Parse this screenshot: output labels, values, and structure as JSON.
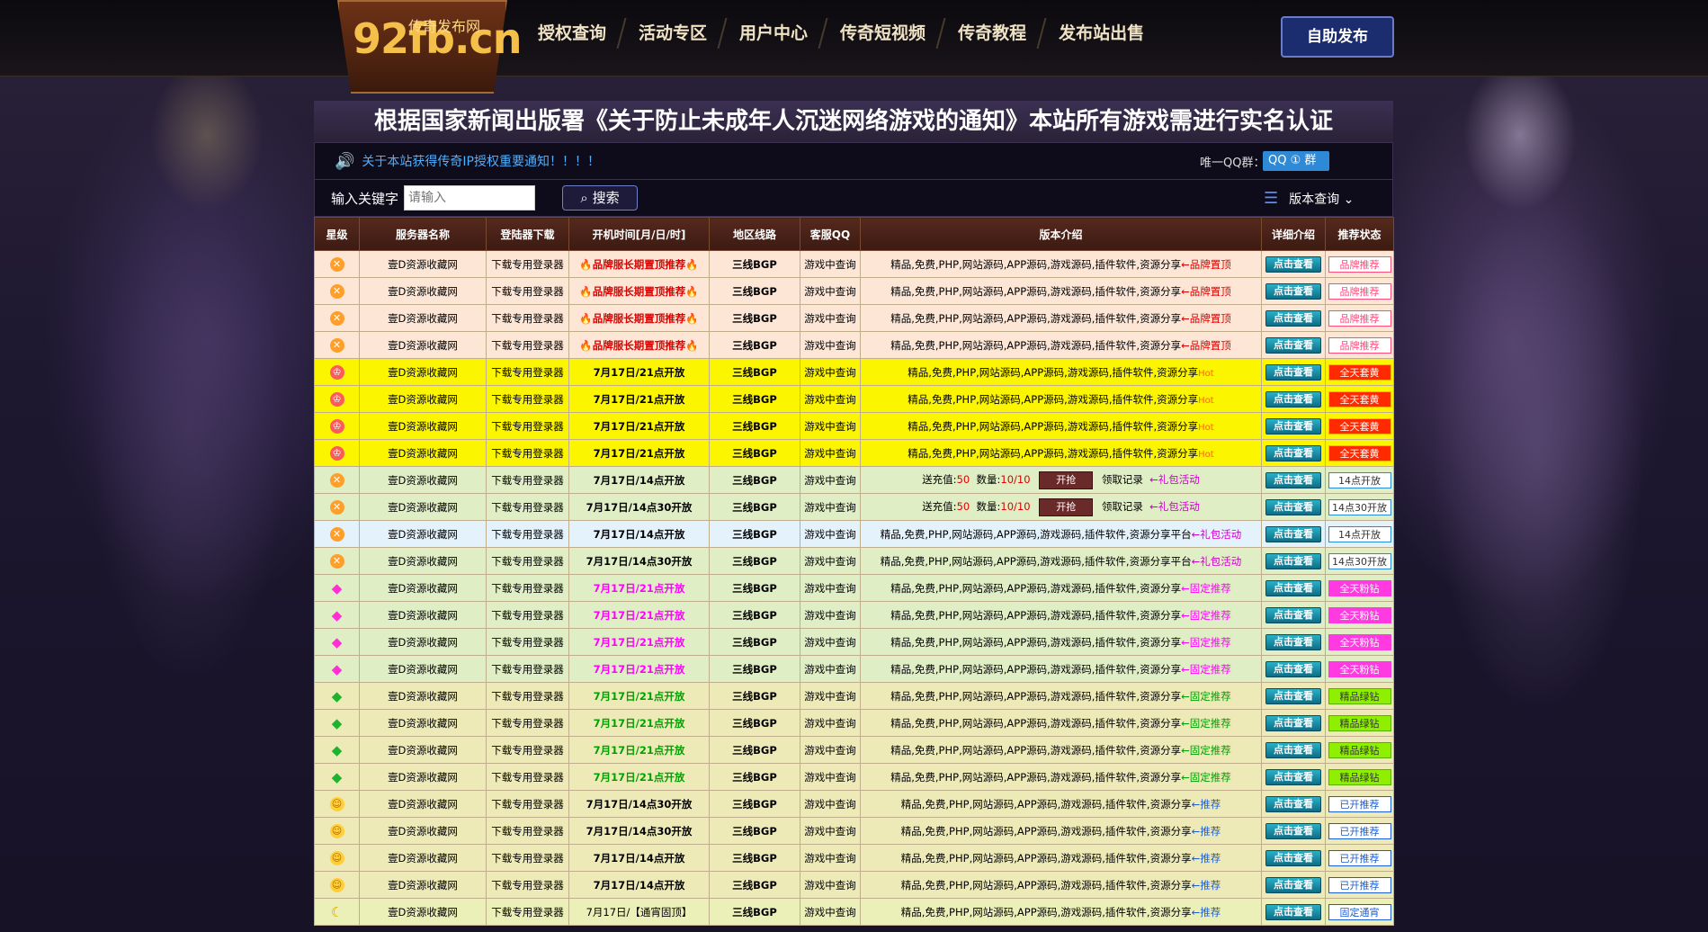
{
  "site": {
    "logo_main": "92fb.cn",
    "logo_sub": "传奇发布网",
    "nav": [
      "授权查询",
      "活动专区",
      "用户中心",
      "传奇短视频",
      "传奇教程",
      "发布站出售"
    ],
    "publish_button": "自助发布"
  },
  "headline": "根据国家新闻出版署《关于防止未成年人沉迷网络游戏的通知》本站所有游戏需进行实名认证",
  "notice": {
    "text": "关于本站获得传奇IP授权重要通知！！！！",
    "qq_label": "唯一QQ群：",
    "qq_badge": "QQ ① 群"
  },
  "search": {
    "label": "输入关键字",
    "placeholder": "请输入",
    "button": "搜索",
    "version_query": "版本查询"
  },
  "table": {
    "headers": [
      "星级",
      "服务器名称",
      "登陆器下载",
      "开机时间[月/日/时]",
      "地区线路",
      "客服QQ",
      "版本介绍",
      "详细介绍",
      "推荐状态"
    ],
    "rows": [
      {
        "style": "pink",
        "star": "orange",
        "name": "壹D资源收藏网",
        "download": "下载专用登录器",
        "time": "🔥品牌服长期置顶推荐🔥",
        "time_style": "time-red",
        "route": "三线BGP",
        "qq": "游戏中查询",
        "intro": "精品,免费,PHP,网站源码,APP源码,游戏源码,插件软件,资源分享",
        "tag": "←品牌置顶",
        "tag_style": "tag-red",
        "detail": "点击查看",
        "status": "品牌推荐",
        "status_style": "s-brand"
      },
      {
        "style": "pink",
        "star": "orange",
        "name": "壹D资源收藏网",
        "download": "下载专用登录器",
        "time": "🔥品牌服长期置顶推荐🔥",
        "time_style": "time-red",
        "route": "三线BGP",
        "qq": "游戏中查询",
        "intro": "精品,免费,PHP,网站源码,APP源码,游戏源码,插件软件,资源分享",
        "tag": "←品牌置顶",
        "tag_style": "tag-red",
        "detail": "点击查看",
        "status": "品牌推荐",
        "status_style": "s-brand"
      },
      {
        "style": "pink",
        "star": "orange",
        "name": "壹D资源收藏网",
        "download": "下载专用登录器",
        "time": "🔥品牌服长期置顶推荐🔥",
        "time_style": "time-red",
        "route": "三线BGP",
        "qq": "游戏中查询",
        "intro": "精品,免费,PHP,网站源码,APP源码,游戏源码,插件软件,资源分享",
        "tag": "←品牌置顶",
        "tag_style": "tag-red",
        "detail": "点击查看",
        "status": "品牌推荐",
        "status_style": "s-brand"
      },
      {
        "style": "pink",
        "star": "orange",
        "name": "壹D资源收藏网",
        "download": "下载专用登录器",
        "time": "🔥品牌服长期置顶推荐🔥",
        "time_style": "time-red",
        "route": "三线BGP",
        "qq": "游戏中查询",
        "intro": "精品,免费,PHP,网站源码,APP源码,游戏源码,插件软件,资源分享",
        "tag": "←品牌置顶",
        "tag_style": "tag-red",
        "detail": "点击查看",
        "status": "品牌推荐",
        "status_style": "s-brand"
      },
      {
        "style": "yellow",
        "star": "crown",
        "name": "壹D资源收藏网",
        "download": "下载专用登录器",
        "time": "7月17日/21点开放",
        "time_style": "time-bold",
        "route": "三线BGP",
        "qq": "游戏中查询",
        "intro": "精品,免费,PHP,网站源码,APP源码,游戏源码,插件软件,资源分享",
        "tag": "Hot",
        "tag_style": "tag-hot",
        "detail": "点击查看",
        "status": "全天套黄",
        "status_style": "s-allday"
      },
      {
        "style": "yellow",
        "star": "crown",
        "name": "壹D资源收藏网",
        "download": "下载专用登录器",
        "time": "7月17日/21点开放",
        "time_style": "time-bold",
        "route": "三线BGP",
        "qq": "游戏中查询",
        "intro": "精品,免费,PHP,网站源码,APP源码,游戏源码,插件软件,资源分享",
        "tag": "Hot",
        "tag_style": "tag-hot",
        "detail": "点击查看",
        "status": "全天套黄",
        "status_style": "s-allday"
      },
      {
        "style": "yellow",
        "star": "crown",
        "name": "壹D资源收藏网",
        "download": "下载专用登录器",
        "time": "7月17日/21点开放",
        "time_style": "time-bold",
        "route": "三线BGP",
        "qq": "游戏中查询",
        "intro": "精品,免费,PHP,网站源码,APP源码,游戏源码,插件软件,资源分享",
        "tag": "Hot",
        "tag_style": "tag-hot",
        "detail": "点击查看",
        "status": "全天套黄",
        "status_style": "s-allday"
      },
      {
        "style": "yellow",
        "star": "crown",
        "name": "壹D资源收藏网",
        "download": "下载专用登录器",
        "time": "7月17日/21点开放",
        "time_style": "time-bold",
        "route": "三线BGP",
        "qq": "游戏中查询",
        "intro": "精品,免费,PHP,网站源码,APP源码,游戏源码,插件软件,资源分享",
        "tag": "Hot",
        "tag_style": "tag-hot",
        "detail": "点击查看",
        "status": "全天套黄",
        "status_style": "s-allday"
      },
      {
        "style": "green",
        "star": "orange",
        "name": "壹D资源收藏网",
        "download": "下载专用登录器",
        "time": "7月17日/14点开放",
        "time_style": "time-bold",
        "route": "三线BGP",
        "qq": "游戏中查询",
        "intro": "",
        "charge": {
          "label": "送充值:",
          "value": "50",
          "qty_label": "数量:",
          "qty": "10/10",
          "button": "开抢",
          "record": "领取记录"
        },
        "tag": "←礼包活动",
        "tag_style": "tag-gift",
        "detail": "点击查看",
        "status": "14点开放",
        "status_style": "s-open"
      },
      {
        "style": "green",
        "star": "orange",
        "name": "壹D资源收藏网",
        "download": "下载专用登录器",
        "time": "7月17日/14点30开放",
        "time_style": "time-bold",
        "route": "三线BGP",
        "qq": "游戏中查询",
        "intro": "",
        "charge": {
          "label": "送充值:",
          "value": "50",
          "qty_label": "数量:",
          "qty": "10/10",
          "button": "开抢",
          "record": "领取记录"
        },
        "tag": "←礼包活动",
        "tag_style": "tag-gift",
        "detail": "点击查看",
        "status": "14点30开放",
        "status_style": "s-open"
      },
      {
        "style": "blue",
        "star": "orange",
        "name": "壹D资源收藏网",
        "download": "下载专用登录器",
        "time": "7月17日/14点开放",
        "time_style": "time-bold",
        "route": "三线BGP",
        "qq": "游戏中查询",
        "intro": "精品,免费,PHP,网站源码,APP源码,游戏源码,插件软件,资源分享平台",
        "tag": "←礼包活动",
        "tag_style": "tag-gift",
        "detail": "点击查看",
        "status": "14点开放",
        "status_style": "s-open"
      },
      {
        "style": "green",
        "star": "orange",
        "name": "壹D资源收藏网",
        "download": "下载专用登录器",
        "time": "7月17日/14点30开放",
        "time_style": "time-bold",
        "route": "三线BGP",
        "qq": "游戏中查询",
        "intro": "精品,免费,PHP,网站源码,APP源码,游戏源码,插件软件,资源分享平台",
        "tag": "←礼包活动",
        "tag_style": "tag-gift",
        "detail": "点击查看",
        "status": "14点30开放",
        "status_style": "s-open"
      },
      {
        "style": "green",
        "star": "pinkdia",
        "name": "壹D资源收藏网",
        "download": "下载专用登录器",
        "time": "7月17日/21点开放",
        "time_style": "time-pink",
        "route": "三线BGP",
        "qq": "游戏中查询",
        "intro": "精品,免费,PHP,网站源码,APP源码,游戏源码,插件软件,资源分享",
        "tag": "←固定推荐",
        "tag_style": "tag-pink",
        "detail": "点击查看",
        "status": "全天粉钻",
        "status_style": "s-pink"
      },
      {
        "style": "green",
        "star": "pinkdia",
        "name": "壹D资源收藏网",
        "download": "下载专用登录器",
        "time": "7月17日/21点开放",
        "time_style": "time-pink",
        "route": "三线BGP",
        "qq": "游戏中查询",
        "intro": "精品,免费,PHP,网站源码,APP源码,游戏源码,插件软件,资源分享",
        "tag": "←固定推荐",
        "tag_style": "tag-pink",
        "detail": "点击查看",
        "status": "全天粉钻",
        "status_style": "s-pink"
      },
      {
        "style": "green",
        "star": "pinkdia",
        "name": "壹D资源收藏网",
        "download": "下载专用登录器",
        "time": "7月17日/21点开放",
        "time_style": "time-pink",
        "route": "三线BGP",
        "qq": "游戏中查询",
        "intro": "精品,免费,PHP,网站源码,APP源码,游戏源码,插件软件,资源分享",
        "tag": "←固定推荐",
        "tag_style": "tag-pink",
        "detail": "点击查看",
        "status": "全天粉钻",
        "status_style": "s-pink"
      },
      {
        "style": "green",
        "star": "pinkdia",
        "name": "壹D资源收藏网",
        "download": "下载专用登录器",
        "time": "7月17日/21点开放",
        "time_style": "time-pink",
        "route": "三线BGP",
        "qq": "游戏中查询",
        "intro": "精品,免费,PHP,网站源码,APP源码,游戏源码,插件软件,资源分享",
        "tag": "←固定推荐",
        "tag_style": "tag-pink",
        "detail": "点击查看",
        "status": "全天粉钻",
        "status_style": "s-pink"
      },
      {
        "style": "khaki",
        "star": "greendia",
        "name": "壹D资源收藏网",
        "download": "下载专用登录器",
        "time": "7月17日/21点开放",
        "time_style": "time-green",
        "route": "三线BGP",
        "qq": "游戏中查询",
        "intro": "精品,免费,PHP,网站源码,APP源码,游戏源码,插件软件,资源分享",
        "tag": "←固定推荐",
        "tag_style": "tag-green",
        "detail": "点击查看",
        "status": "精品绿钻",
        "status_style": "s-green"
      },
      {
        "style": "khaki",
        "star": "greendia",
        "name": "壹D资源收藏网",
        "download": "下载专用登录器",
        "time": "7月17日/21点开放",
        "time_style": "time-green",
        "route": "三线BGP",
        "qq": "游戏中查询",
        "intro": "精品,免费,PHP,网站源码,APP源码,游戏源码,插件软件,资源分享",
        "tag": "←固定推荐",
        "tag_style": "tag-green",
        "detail": "点击查看",
        "status": "精品绿钻",
        "status_style": "s-green"
      },
      {
        "style": "khaki",
        "star": "greendia",
        "name": "壹D资源收藏网",
        "download": "下载专用登录器",
        "time": "7月17日/21点开放",
        "time_style": "time-green",
        "route": "三线BGP",
        "qq": "游戏中查询",
        "intro": "精品,免费,PHP,网站源码,APP源码,游戏源码,插件软件,资源分享",
        "tag": "←固定推荐",
        "tag_style": "tag-green",
        "detail": "点击查看",
        "status": "精品绿钻",
        "status_style": "s-green"
      },
      {
        "style": "khaki",
        "star": "greendia",
        "name": "壹D资源收藏网",
        "download": "下载专用登录器",
        "time": "7月17日/21点开放",
        "time_style": "time-green",
        "route": "三线BGP",
        "qq": "游戏中查询",
        "intro": "精品,免费,PHP,网站源码,APP源码,游戏源码,插件软件,资源分享",
        "tag": "←固定推荐",
        "tag_style": "tag-green",
        "detail": "点击查看",
        "status": "精品绿钻",
        "status_style": "s-green"
      },
      {
        "style": "khaki",
        "star": "face",
        "name": "壹D资源收藏网",
        "download": "下载专用登录器",
        "time": "7月17日/14点30开放",
        "time_style": "time-bold",
        "route": "三线BGP",
        "qq": "游戏中查询",
        "intro": "精品,免费,PHP,网站源码,APP源码,游戏源码,插件软件,资源分享",
        "tag": "←推荐",
        "tag_style": "tag-blue",
        "detail": "点击查看",
        "status": "已开推荐",
        "status_style": "s-blue"
      },
      {
        "style": "khaki",
        "star": "face",
        "name": "壹D资源收藏网",
        "download": "下载专用登录器",
        "time": "7月17日/14点30开放",
        "time_style": "time-bold",
        "route": "三线BGP",
        "qq": "游戏中查询",
        "intro": "精品,免费,PHP,网站源码,APP源码,游戏源码,插件软件,资源分享",
        "tag": "←推荐",
        "tag_style": "tag-blue",
        "detail": "点击查看",
        "status": "已开推荐",
        "status_style": "s-blue"
      },
      {
        "style": "khaki",
        "star": "face",
        "name": "壹D资源收藏网",
        "download": "下载专用登录器",
        "time": "7月17日/14点开放",
        "time_style": "time-bold",
        "route": "三线BGP",
        "qq": "游戏中查询",
        "intro": "精品,免费,PHP,网站源码,APP源码,游戏源码,插件软件,资源分享",
        "tag": "←推荐",
        "tag_style": "tag-blue",
        "detail": "点击查看",
        "status": "已开推荐",
        "status_style": "s-blue"
      },
      {
        "style": "khaki",
        "star": "face",
        "name": "壹D资源收藏网",
        "download": "下载专用登录器",
        "time": "7月17日/14点开放",
        "time_style": "time-bold",
        "route": "三线BGP",
        "qq": "游戏中查询",
        "intro": "精品,免费,PHP,网站源码,APP源码,游戏源码,插件软件,资源分享",
        "tag": "←推荐",
        "tag_style": "tag-blue",
        "detail": "点击查看",
        "status": "已开推荐",
        "status_style": "s-blue"
      },
      {
        "style": "lime",
        "star": "moon",
        "name": "壹D资源收藏网",
        "download": "下载专用登录器",
        "time": "7月17日/【通宵固顶】",
        "time_style": "",
        "route": "三线BGP",
        "qq": "游戏中查询",
        "intro": "精品,免费,PHP,网站源码,APP源码,游戏源码,插件软件,资源分享",
        "tag": "←推荐",
        "tag_style": "tag-blue",
        "detail": "点击查看",
        "status": "固定通宵",
        "status_style": "s-blue"
      }
    ]
  }
}
